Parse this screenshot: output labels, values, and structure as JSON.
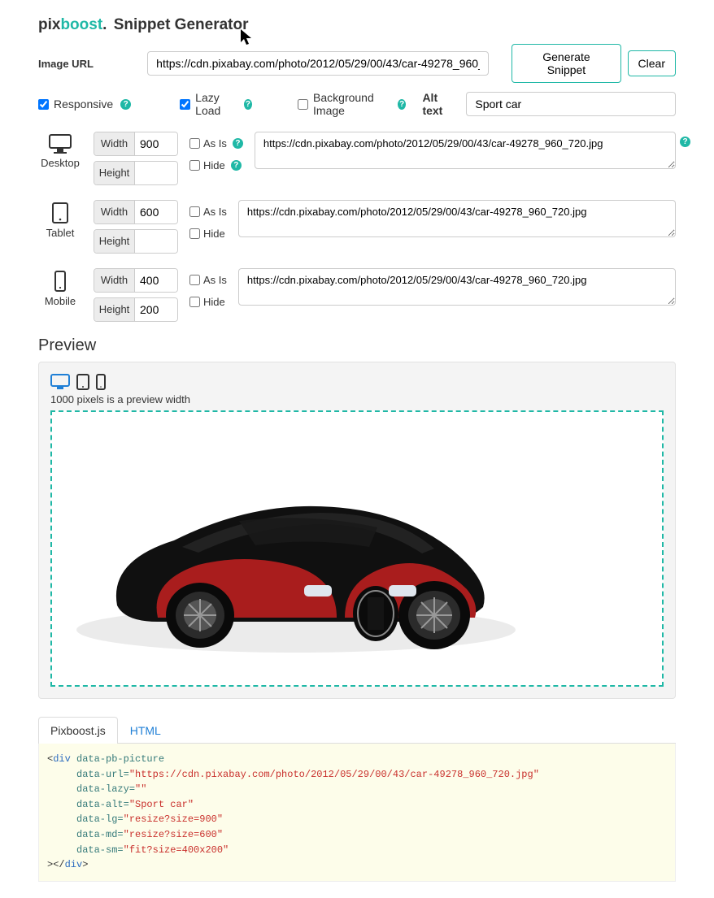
{
  "logo": {
    "pix": "pix",
    "boost": "boost",
    "dot": ".",
    "title": "Snippet Generator"
  },
  "form": {
    "image_url_label": "Image URL",
    "image_url_value": "https://cdn.pixabay.com/photo/2012/05/29/00/43/car-49278_960_720.jpg",
    "generate_btn": "Generate Snippet",
    "clear_btn": "Clear"
  },
  "opts": {
    "responsive": "Responsive",
    "lazy": "Lazy Load",
    "bg": "Background Image",
    "alt_label": "Alt text",
    "alt_value": "Sport car"
  },
  "devices": [
    {
      "name": "Desktop",
      "width": "900",
      "height": "",
      "as_is": "As Is",
      "hide": "Hide",
      "show_help": true,
      "url": "https://cdn.pixabay.com/photo/2012/05/29/00/43/car-49278_960_720.jpg"
    },
    {
      "name": "Tablet",
      "width": "600",
      "height": "",
      "as_is": "As Is",
      "hide": "Hide",
      "show_help": false,
      "url": "https://cdn.pixabay.com/photo/2012/05/29/00/43/car-49278_960_720.jpg"
    },
    {
      "name": "Mobile",
      "width": "400",
      "height": "200",
      "as_is": "As Is",
      "hide": "Hide",
      "show_help": false,
      "url": "https://cdn.pixabay.com/photo/2012/05/29/00/43/car-49278_960_720.jpg"
    }
  ],
  "dim_labels": {
    "width": "Width",
    "height": "Height"
  },
  "preview": {
    "title": "Preview",
    "note": "1000 pixels is a preview width"
  },
  "tabs": {
    "active": "Pixboost.js",
    "inactive": "HTML"
  },
  "code": {
    "line1a": "<",
    "line1b": "div",
    "line1c": " data-pb-picture",
    "l2a": "     data-url=",
    "l2b": "\"https://cdn.pixabay.com/photo/2012/05/29/00/43/car-49278_960_720.jpg\"",
    "l3a": "     data-lazy=",
    "l3b": "\"\"",
    "l4a": "     data-alt=",
    "l4b": "\"Sport car\"",
    "l5a": "     data-lg=",
    "l5b": "\"resize?size=900\"",
    "l6a": "     data-md=",
    "l6b": "\"resize?size=600\"",
    "l7a": "     data-sm=",
    "l7b": "\"fit?size=400x200\"",
    "l8a": "></",
    "l8b": "div",
    "l8c": ">"
  }
}
